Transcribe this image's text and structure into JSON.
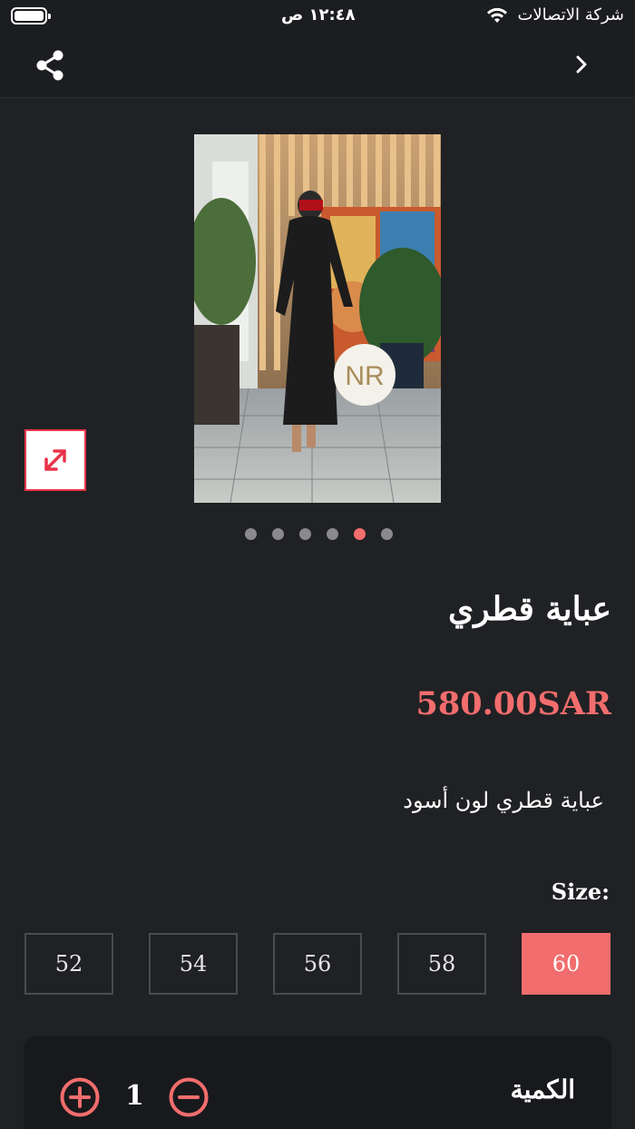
{
  "status_bar": {
    "time": "١٢:٤٨ ص",
    "carrier": "شركة الاتصالات"
  },
  "product": {
    "title": "عباية قطري",
    "price": "580.00SAR",
    "description": "عباية قطري لون أسود",
    "image_logo": "NR",
    "gallery": {
      "count": 6,
      "active_index": 4
    }
  },
  "size": {
    "label": "Size:",
    "options": [
      "52",
      "54",
      "56",
      "58",
      "60"
    ],
    "selected": "60"
  },
  "quantity": {
    "label": "الكمية",
    "value": "1"
  },
  "icons": {
    "share": "share-icon",
    "back": "chevron-right-icon",
    "expand": "expand-icon",
    "plus": "plus-circle-icon",
    "minus": "minus-circle-icon"
  },
  "colors": {
    "background": "#202124",
    "accent": "#f26d6d",
    "expand_border": "#e8334a"
  }
}
